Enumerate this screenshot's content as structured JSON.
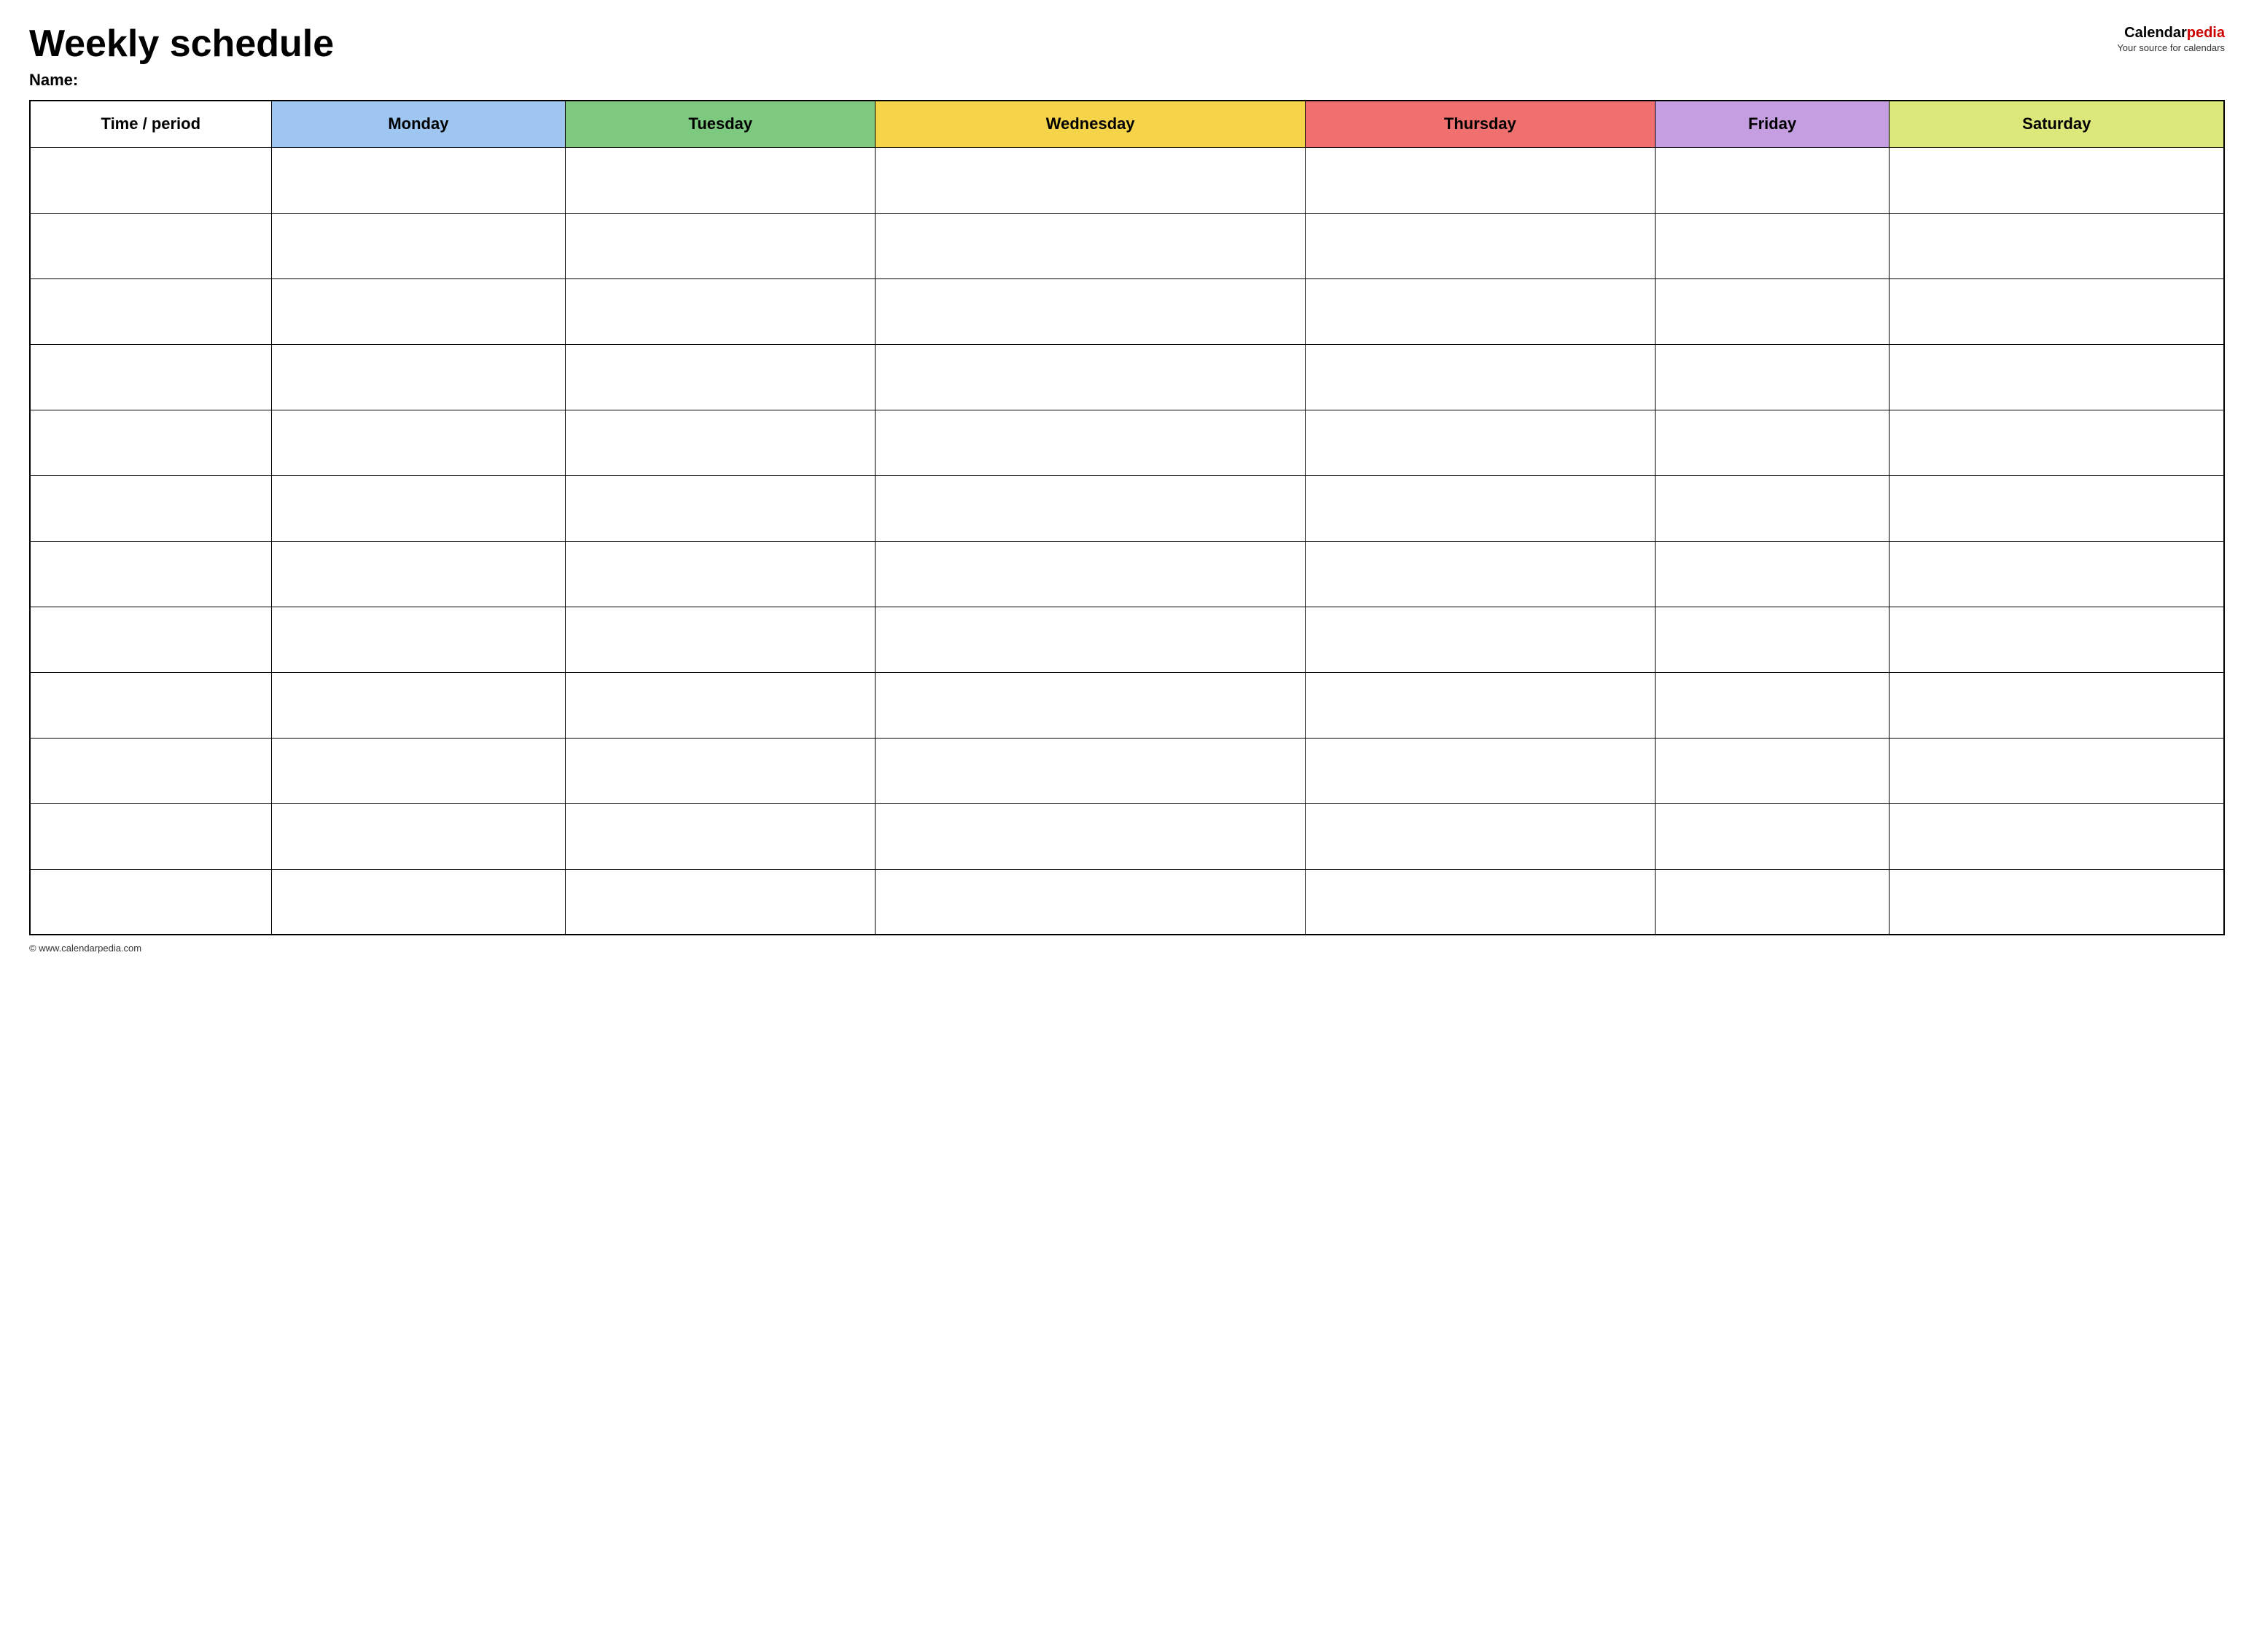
{
  "header": {
    "title": "Weekly schedule",
    "name_label": "Name:",
    "brand": {
      "name_part1": "Calendar",
      "name_part2_red": "pedia",
      "tagline": "Your source for calendars"
    }
  },
  "table": {
    "columns": [
      {
        "id": "time",
        "label": "Time / period",
        "color": "#ffffff"
      },
      {
        "id": "monday",
        "label": "Monday",
        "color": "#9ec6f0"
      },
      {
        "id": "tuesday",
        "label": "Tuesday",
        "color": "#7dc97f"
      },
      {
        "id": "wednesday",
        "label": "Wednesday",
        "color": "#f5d44a"
      },
      {
        "id": "thursday",
        "label": "Thursday",
        "color": "#f07070"
      },
      {
        "id": "friday",
        "label": "Friday",
        "color": "#c49ee0"
      },
      {
        "id": "saturday",
        "label": "Saturday",
        "color": "#dce97a"
      }
    ],
    "row_count": 12
  },
  "footer": {
    "url": "© www.calendarpedia.com"
  }
}
